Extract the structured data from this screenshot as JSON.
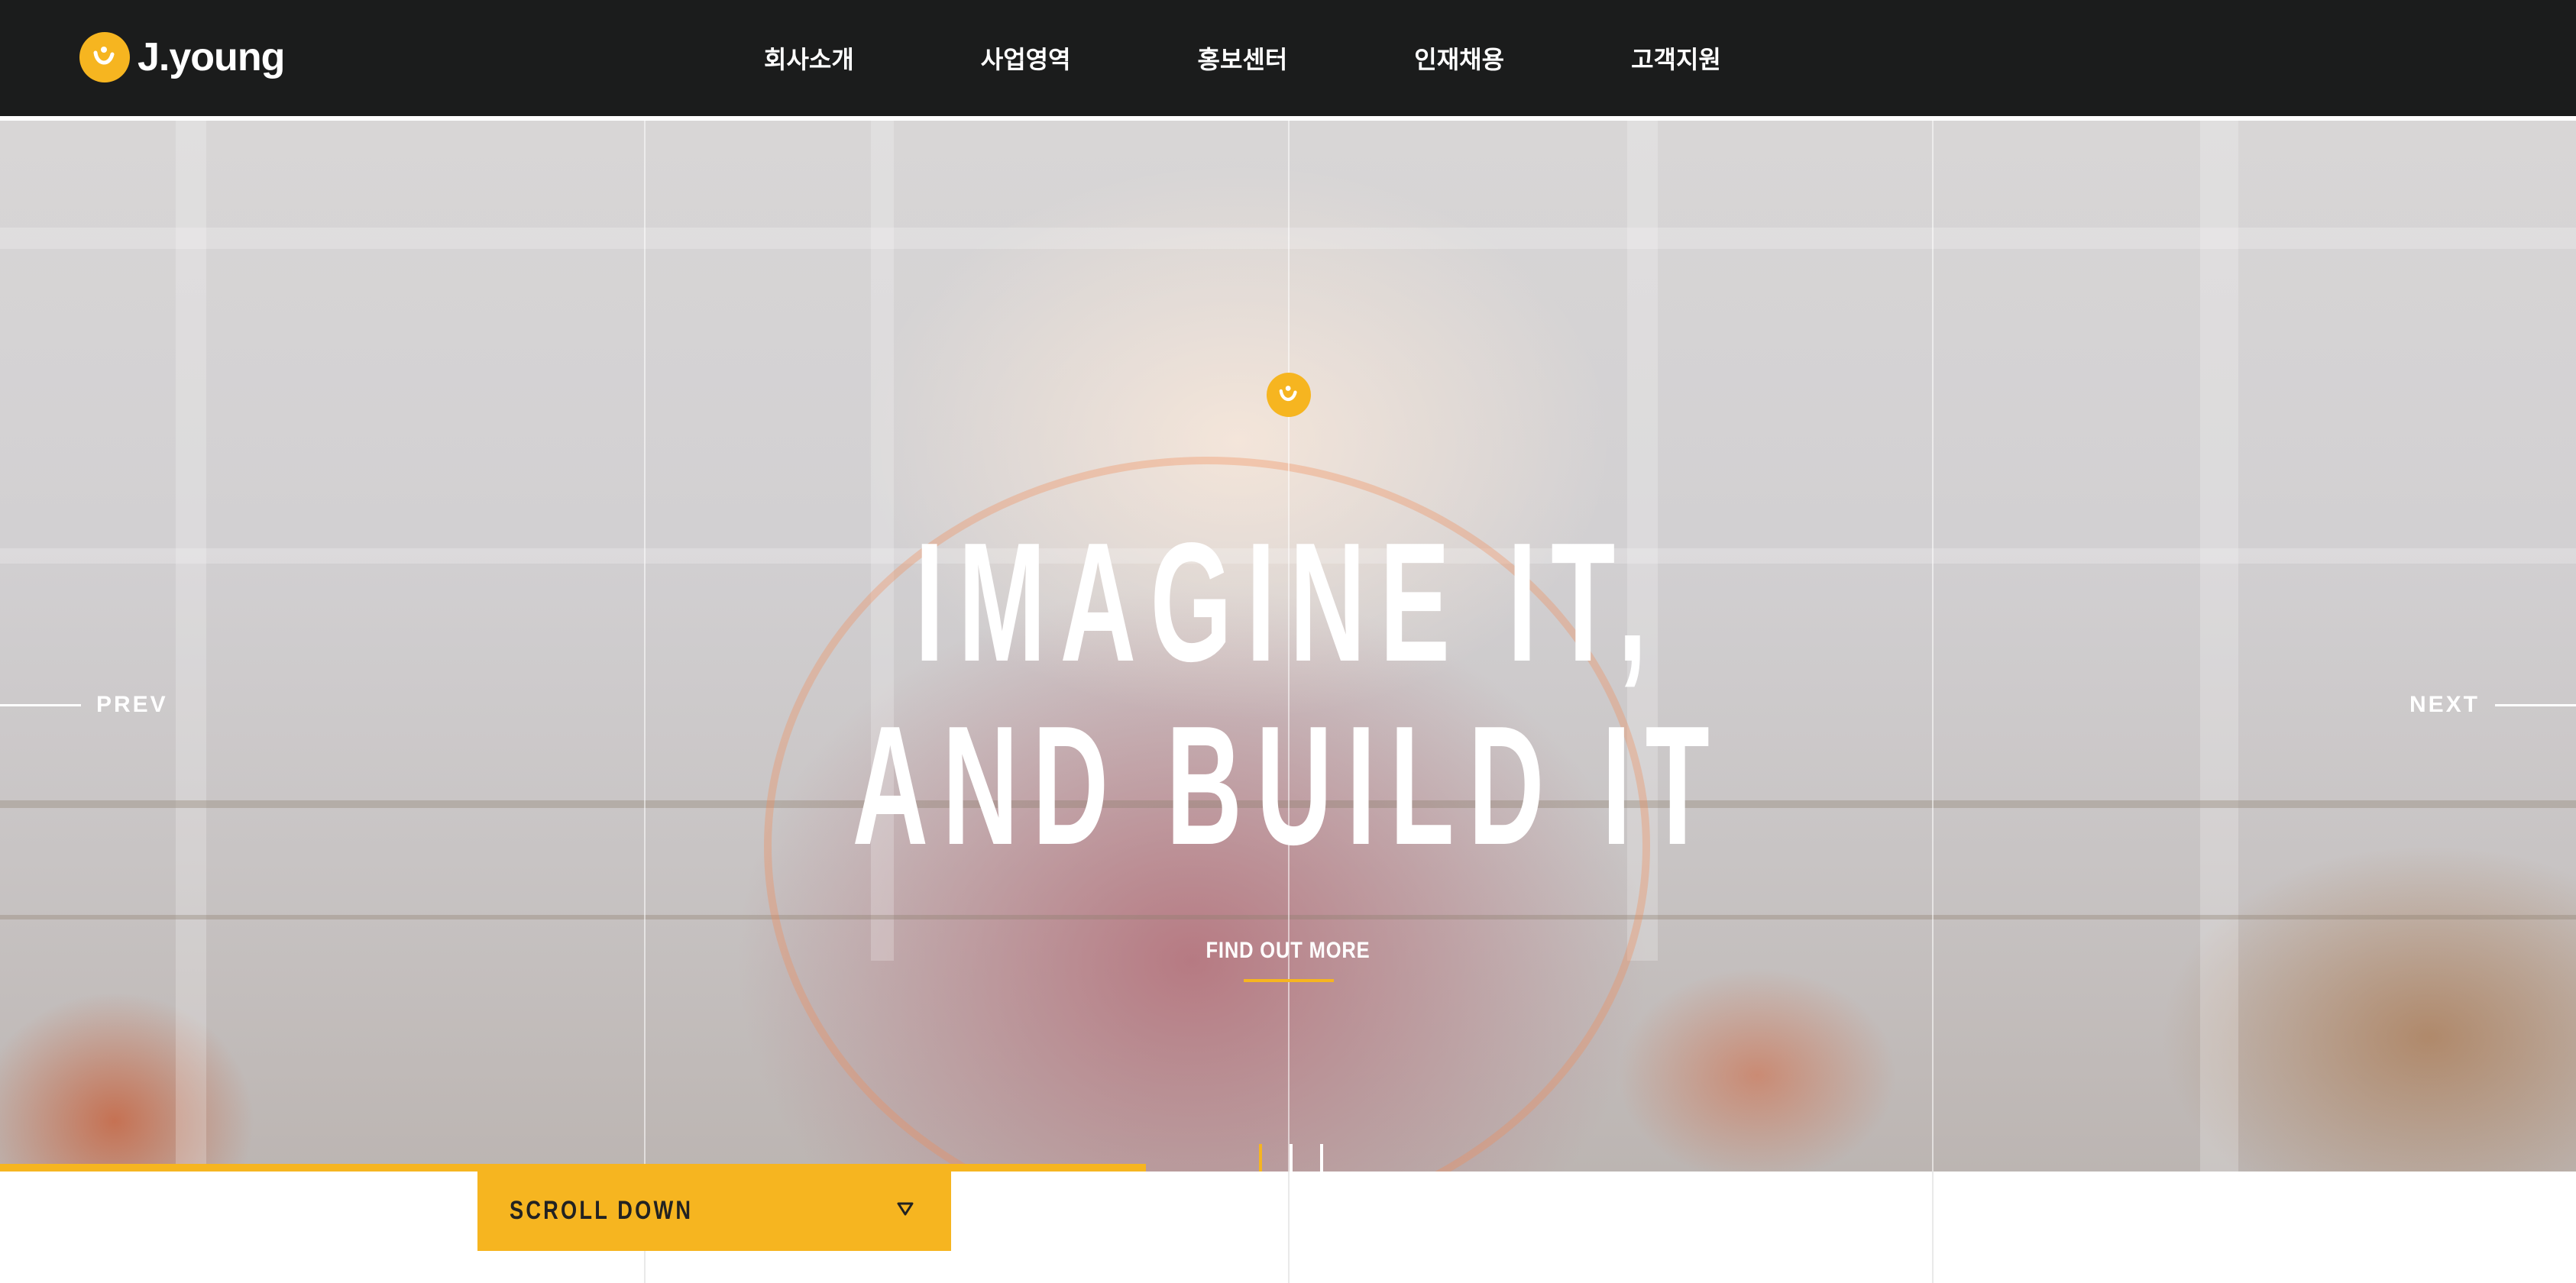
{
  "brand": {
    "name": "J.young",
    "mark_letter": "J",
    "accent_color": "#f6b520",
    "header_bg": "#1b1c1c"
  },
  "nav": {
    "items": [
      {
        "label": "회사소개"
      },
      {
        "label": "사업영역"
      },
      {
        "label": "홍보센터"
      },
      {
        "label": "인재채용"
      },
      {
        "label": "고객지원"
      }
    ]
  },
  "hero": {
    "mark_icon": "brand-mark-icon",
    "headline_line1": "IMAGINE IT,",
    "headline_line2": "AND BUILD IT",
    "cta_label": "FIND OUT MORE",
    "prev_label": "PREV",
    "next_label": "NEXT",
    "slide_count": 3,
    "active_slide": 1,
    "indicator_active_color": "#f6b520",
    "indicator_inactive_color": "#ffffff",
    "background_image": "man-at-desk-photo"
  },
  "scroll": {
    "label": "SCROLL DOWN",
    "icon": "triangle-down-icon"
  }
}
